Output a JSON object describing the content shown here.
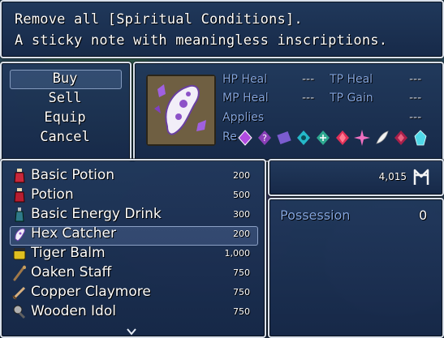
{
  "help": {
    "line1": "Remove all [Spiritual Conditions].",
    "line2": "A sticky note with meaningless inscriptions."
  },
  "commands": [
    {
      "label": "Buy",
      "selected": true
    },
    {
      "label": "Sell"
    },
    {
      "label": "Equip"
    },
    {
      "label": "Cancel"
    }
  ],
  "item_info": {
    "icon": "hex-catcher-scroll-icon",
    "stats": {
      "hp_heal_label": "HP Heal",
      "hp_heal_value": "---",
      "tp_heal_label": "TP Heal",
      "tp_heal_value": "---",
      "mp_heal_label": "MP Heal",
      "mp_heal_value": "---",
      "tp_gain_label": "TP Gain",
      "tp_gain_value": "---",
      "applies_label": "Applies",
      "applies_value": "---",
      "removes_label": "Re"
    },
    "removed_state_icons": [
      "purple-diamond-icon",
      "question-mark-icon",
      "purple-card-icon",
      "cyan-rune-icon",
      "teal-rune-icon",
      "red-gem-icon",
      "pink-sparkle-icon",
      "white-feather-icon",
      "crimson-diamond-icon",
      "cyan-crystal-icon"
    ]
  },
  "gold": {
    "amount": "4,015",
    "currency_icon": "currency-rune-icon"
  },
  "possession": {
    "label": "Possession",
    "value": "0"
  },
  "items": [
    {
      "name": "Basic Potion",
      "price": "200",
      "icon": "red-potion-icon"
    },
    {
      "name": "Potion",
      "price": "500",
      "icon": "red-potion-icon"
    },
    {
      "name": "Basic Energy Drink",
      "price": "300",
      "icon": "teal-bottle-icon"
    },
    {
      "name": "Hex Catcher",
      "price": "200",
      "icon": "hex-catcher-scroll-icon",
      "selected": true
    },
    {
      "name": "Tiger Balm",
      "price": "1,000",
      "icon": "balm-jar-icon"
    },
    {
      "name": "Oaken Staff",
      "price": "750",
      "icon": "staff-icon"
    },
    {
      "name": "Copper Claymore",
      "price": "750",
      "icon": "sword-icon"
    },
    {
      "name": "Wooden Idol",
      "price": "750",
      "icon": "idol-icon"
    }
  ],
  "colors": {
    "window_border": "#d9e0ea",
    "system_label": "#84a6e0",
    "window_bg": "#1c3460"
  }
}
